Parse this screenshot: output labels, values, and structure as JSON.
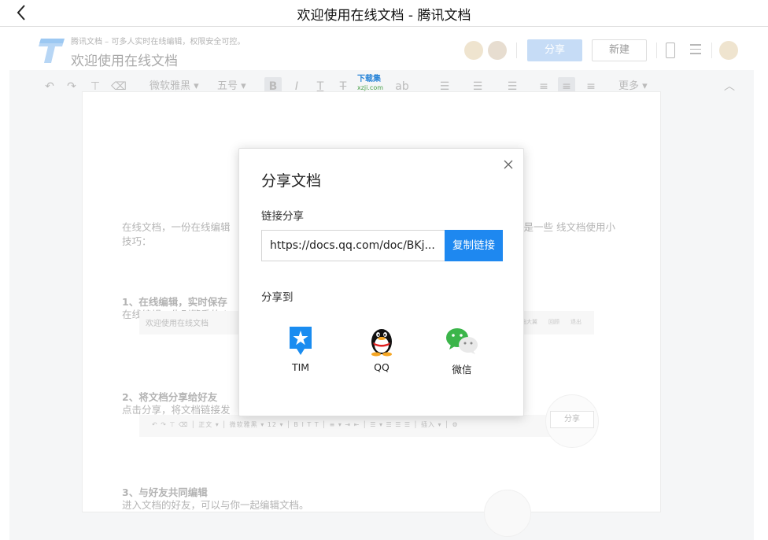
{
  "titlebar": {
    "title": "欢迎使用在线文档 - 腾讯文档"
  },
  "appbar": {
    "subtitle": "腾讯文档 – 可多人实时在线编辑，权限安全可控。",
    "doc_title": "欢迎使用在线文档",
    "share_label": "分享",
    "new_label": "新建"
  },
  "toolbar": {
    "font": "微软雅黑",
    "size": "五号",
    "more": "更多",
    "watermark_top": "下载集",
    "watermark_bottom": "xzji.com"
  },
  "document": {
    "intro_left": "在线文档，一份在线编辑",
    "intro_right": "下是一些 线文档使用小",
    "intro_line2": "技巧：",
    "h1": "1、在线编辑，实时保存",
    "p1": "在线编辑，告别繁重的d",
    "shot1_title": "欢迎使用在线文档",
    "shot1_right": "施大翼　　回顾　　退出",
    "h2": "2、将文档分享给好友",
    "p2": "点击分享，将文档链接发",
    "shot2_tools": "↶ ↷ ⊤ ⌫ │ 正文 ▾ │ 微软雅黑 ▾ 12 ▾ │ B I T T │ ≡ ▾ ⇥ ⇤ │ ☰ ▾ ☰ ☰ ☰ │ 插入 ▾ │ ⚙",
    "mini_share": "分享",
    "h3": "3、与好友共同编辑",
    "p3": "进入文档的好友，可以与你一起编辑文档。"
  },
  "dialog": {
    "title": "分享文档",
    "link_label": "链接分享",
    "link_value": "https://docs.qq.com/doc/BKj...",
    "copy_label": "复制链接",
    "share_to_label": "分享到",
    "targets": [
      {
        "label": "TIM",
        "icon": "tim-icon"
      },
      {
        "label": "QQ",
        "icon": "qq-icon"
      },
      {
        "label": "微信",
        "icon": "wechat-icon"
      }
    ]
  },
  "colors": {
    "accent": "#1e88f0",
    "share_dim": "#c6dcf6",
    "wechat": "#3bb54a",
    "tim": "#1a8cf0"
  }
}
